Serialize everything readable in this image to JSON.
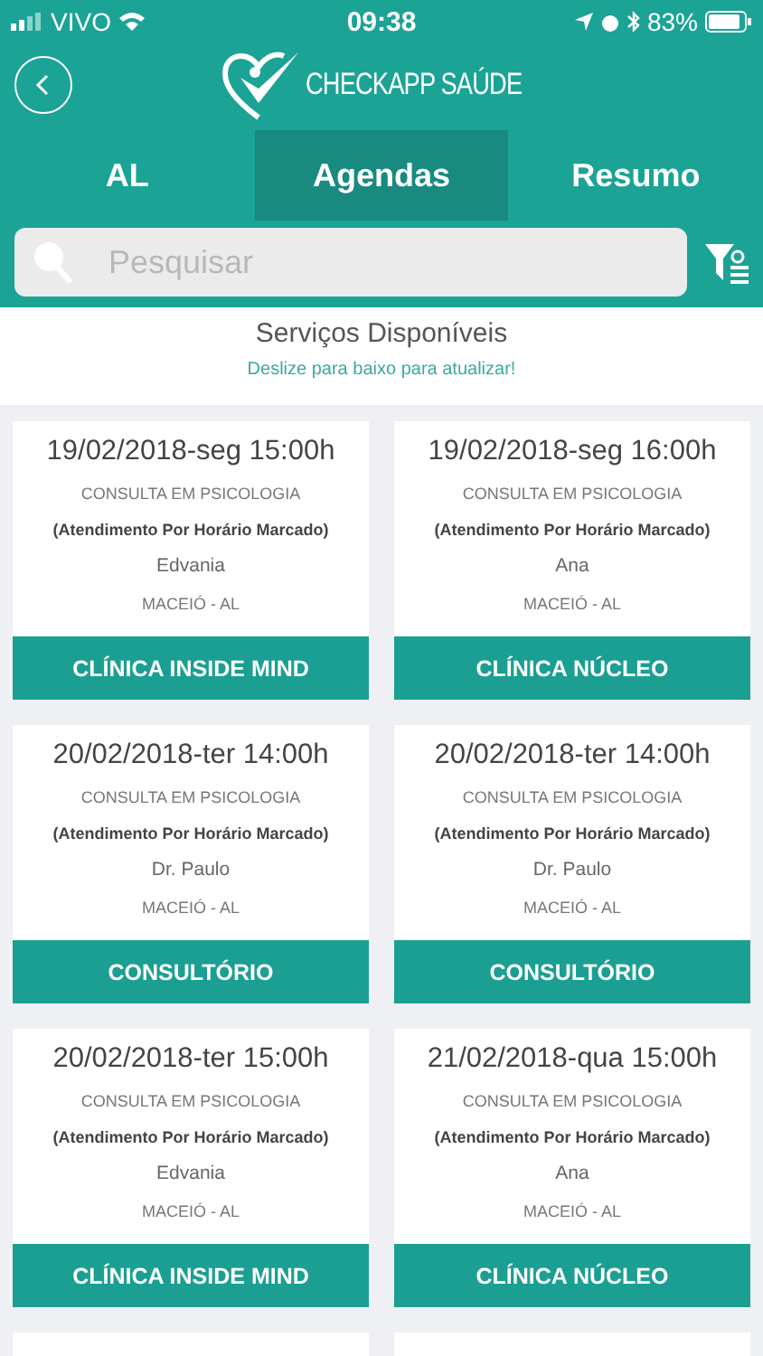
{
  "status_bar": {
    "carrier": "VIVO",
    "time": "09:38",
    "battery": "83%"
  },
  "header": {
    "brand": "CHECKAPP SAÚDE"
  },
  "tabs": [
    {
      "label": "AL",
      "selected": false
    },
    {
      "label": "Agendas",
      "selected": true
    },
    {
      "label": "Resumo",
      "selected": false
    }
  ],
  "search": {
    "placeholder": "Pesquisar"
  },
  "section": {
    "title": "Serviços Disponíveis",
    "hint": "Deslize para baixo para atualizar!"
  },
  "cards": [
    {
      "datetime": "19/02/2018-seg 15:00h",
      "service": "CONSULTA EM PSICOLOGIA",
      "mode": "(Atendimento Por Horário Marcado)",
      "professional": "Edvania",
      "city": "MACEIÓ - AL",
      "clinic": "CLÍNICA INSIDE MIND"
    },
    {
      "datetime": "19/02/2018-seg 16:00h",
      "service": "CONSULTA EM PSICOLOGIA",
      "mode": "(Atendimento Por Horário Marcado)",
      "professional": "Ana",
      "city": "MACEIÓ - AL",
      "clinic": "CLÍNICA NÚCLEO"
    },
    {
      "datetime": "20/02/2018-ter 14:00h",
      "service": "CONSULTA EM PSICOLOGIA",
      "mode": "(Atendimento Por Horário Marcado)",
      "professional": "Dr. Paulo",
      "city": "MACEIÓ - AL",
      "clinic": "CONSULTÓRIO"
    },
    {
      "datetime": "20/02/2018-ter 14:00h",
      "service": "CONSULTA EM PSICOLOGIA",
      "mode": "(Atendimento Por Horário Marcado)",
      "professional": "Dr. Paulo",
      "city": "MACEIÓ - AL",
      "clinic": "CONSULTÓRIO"
    },
    {
      "datetime": "20/02/2018-ter 15:00h",
      "service": "CONSULTA EM PSICOLOGIA",
      "mode": "(Atendimento Por Horário Marcado)",
      "professional": "Edvania",
      "city": "MACEIÓ - AL",
      "clinic": "CLÍNICA INSIDE MIND"
    },
    {
      "datetime": "21/02/2018-qua 15:00h",
      "service": "CONSULTA EM PSICOLOGIA",
      "mode": "(Atendimento Por Horário Marcado)",
      "professional": "Ana",
      "city": "MACEIÓ - AL",
      "clinic": "CLÍNICA NÚCLEO"
    }
  ]
}
